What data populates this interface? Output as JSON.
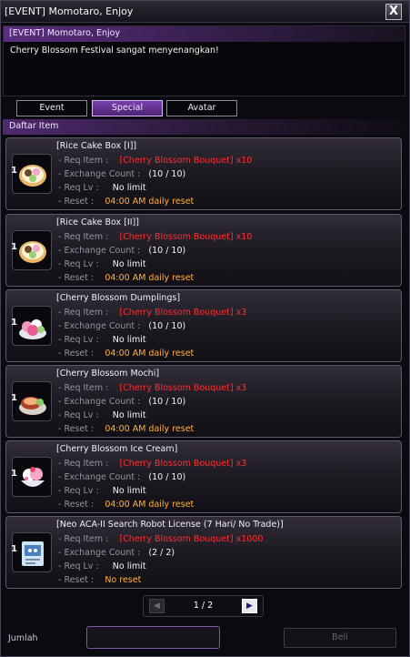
{
  "window": {
    "title": "[EVENT] Momotaro, Enjoy",
    "close_label": "X"
  },
  "npc": {
    "name": "[EVENT] Momotaro, Enjoy",
    "message": "Cherry Blossom Festival sangat menyenangkan!"
  },
  "tabs": [
    {
      "label": "Event",
      "active": false
    },
    {
      "label": "Special",
      "active": true
    },
    {
      "label": "Avatar",
      "active": false
    }
  ],
  "list": {
    "header": "Daftar Item",
    "labels": {
      "req_item": "- Req Item :",
      "exchange_count": "- Exchange Count :",
      "req_lv": "- Req Lv :",
      "reset": "- Reset :"
    },
    "items": [
      {
        "name": "[Rice Cake Box [I]]",
        "icon": "rice-cake-box-icon",
        "qty": "1",
        "req_item": "[Cherry Blossom Bouquet] x10",
        "exchange_count": "(10 / 10)",
        "req_lv": "No limit",
        "reset": "04:00 AM daily reset"
      },
      {
        "name": "[Rice Cake Box [II]]",
        "icon": "rice-cake-box-icon",
        "qty": "1",
        "req_item": "[Cherry Blossom Bouquet] x10",
        "exchange_count": "(10 / 10)",
        "req_lv": "No limit",
        "reset": "04:00 AM daily reset"
      },
      {
        "name": "[Cherry Blossom Dumplings]",
        "icon": "dumplings-icon",
        "qty": "1",
        "req_item": "[Cherry Blossom Bouquet] x3",
        "exchange_count": "(10 / 10)",
        "req_lv": "No limit",
        "reset": "04:00 AM daily reset"
      },
      {
        "name": "[Cherry Blossom Mochi]",
        "icon": "mochi-icon",
        "qty": "1",
        "req_item": "[Cherry Blossom Bouquet] x3",
        "exchange_count": "(10 / 10)",
        "req_lv": "No limit",
        "reset": "04:00 AM daily reset"
      },
      {
        "name": "[Cherry Blossom Ice Cream]",
        "icon": "ice-cream-icon",
        "qty": "1",
        "req_item": "[Cherry Blossom Bouquet] x3",
        "exchange_count": "(10 / 10)",
        "req_lv": "No limit",
        "reset": "04:00 AM daily reset"
      },
      {
        "name": "[Neo ACA-II Search Robot License (7 Hari/ No Trade)]",
        "icon": "robot-license-icon",
        "qty": "1",
        "req_item": "[Cherry Blossom Bouquet] x1000",
        "exchange_count": "(2 / 2)",
        "req_lv": "No limit",
        "reset": "No reset"
      }
    ]
  },
  "pager": {
    "prev_label": "◀",
    "page": "1 / 2",
    "next_label": "▶"
  },
  "footer": {
    "jumlah_label": "Jumlah",
    "jumlah_value": "",
    "beli_label": "Beli"
  },
  "colors": {
    "accent": "#7a3fb0",
    "req_item": "#ff2e2e",
    "reset": "#ffb23a"
  }
}
